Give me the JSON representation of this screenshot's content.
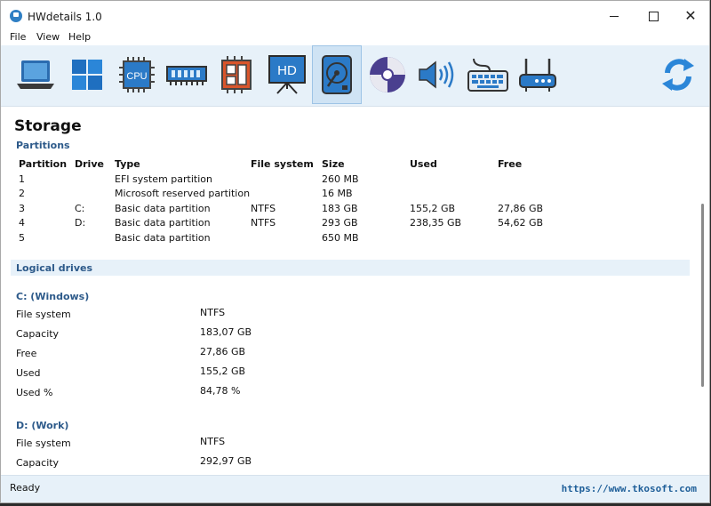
{
  "window": {
    "title": "HWdetails 1.0"
  },
  "menu": {
    "file": "File",
    "view": "View",
    "help": "Help"
  },
  "toolbar": {
    "active": "storage",
    "cpu_label": "CPU",
    "hd_label": "HD",
    "icons": [
      "laptop-icon",
      "windows-logo-icon",
      "cpu-icon",
      "memory-icon",
      "motherboard-icon",
      "display-icon",
      "harddisk-icon",
      "optical-disc-icon",
      "speaker-icon",
      "keyboard-icon",
      "router-icon",
      "refresh-icon"
    ]
  },
  "page": {
    "title": "Storage"
  },
  "partitions": {
    "label": "Partitions",
    "columns": [
      "Partition",
      "Drive",
      "Type",
      "File system",
      "Size",
      "Used",
      "Free"
    ],
    "rows": [
      [
        "1",
        "",
        "EFI system partition",
        "",
        "260 MB",
        "",
        ""
      ],
      [
        "2",
        "",
        "Microsoft reserved partition",
        "",
        "16 MB",
        "",
        ""
      ],
      [
        "3",
        "C:",
        "Basic data partition",
        "NTFS",
        "183 GB",
        "155,2 GB",
        "27,86 GB"
      ],
      [
        "4",
        "D:",
        "Basic data partition",
        "NTFS",
        "293 GB",
        "238,35 GB",
        "54,62 GB"
      ],
      [
        "5",
        "",
        "Basic data partition",
        "",
        "650 MB",
        "",
        ""
      ]
    ]
  },
  "logical": {
    "label": "Logical drives",
    "drives": [
      {
        "name": "C: (Windows)",
        "props": [
          [
            "File system",
            "NTFS"
          ],
          [
            "Capacity",
            "183,07 GB"
          ],
          [
            "Free",
            "27,86 GB"
          ],
          [
            "Used",
            "155,2 GB"
          ],
          [
            "Used %",
            "84,78 %"
          ]
        ]
      },
      {
        "name": "D: (Work)",
        "props": [
          [
            "File system",
            "NTFS"
          ],
          [
            "Capacity",
            "292,97 GB"
          ]
        ]
      }
    ]
  },
  "status": {
    "text": "Ready",
    "link": "https://www.tkosoft.com"
  },
  "colors": {
    "accent": "#2f7fc4",
    "toolbar_bg": "#e7f1f9",
    "section_text": "#2d5a8a"
  }
}
